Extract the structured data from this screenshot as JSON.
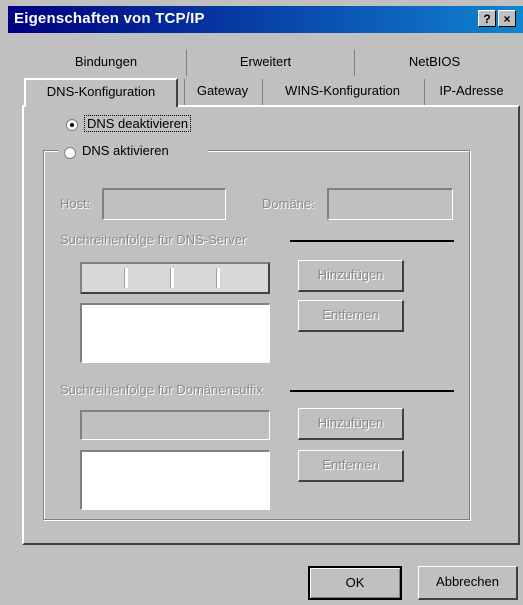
{
  "window": {
    "title": "Eigenschaften von TCP/IP",
    "help_label": "?",
    "close_label": "×"
  },
  "tabs": {
    "row1": [
      "Bindungen",
      "Erweitert",
      "NetBIOS"
    ],
    "row2": [
      "DNS-Konfiguration",
      "Gateway",
      "WINS-Konfiguration",
      "IP-Adresse"
    ],
    "active": "DNS-Konfiguration"
  },
  "dns": {
    "disable_label": "DNS deaktivieren",
    "enable_label": "DNS aktivieren",
    "selected": "DNS deaktivieren",
    "host_label": "Host:",
    "domain_label": "Domäne:",
    "host_value": "",
    "domain_value": "",
    "server_order_label": "Suchreihenfolge für DNS-Server",
    "add_label_1": "Hinzufügen",
    "remove_label_1": "Entfernen",
    "suffix_order_label": "Suchreihenfolge für Domänensuffix",
    "add_label_2": "Hinzufügen",
    "remove_label_2": "Entfernen"
  },
  "footer": {
    "ok_label": "OK",
    "cancel_label": "Abbrechen"
  }
}
